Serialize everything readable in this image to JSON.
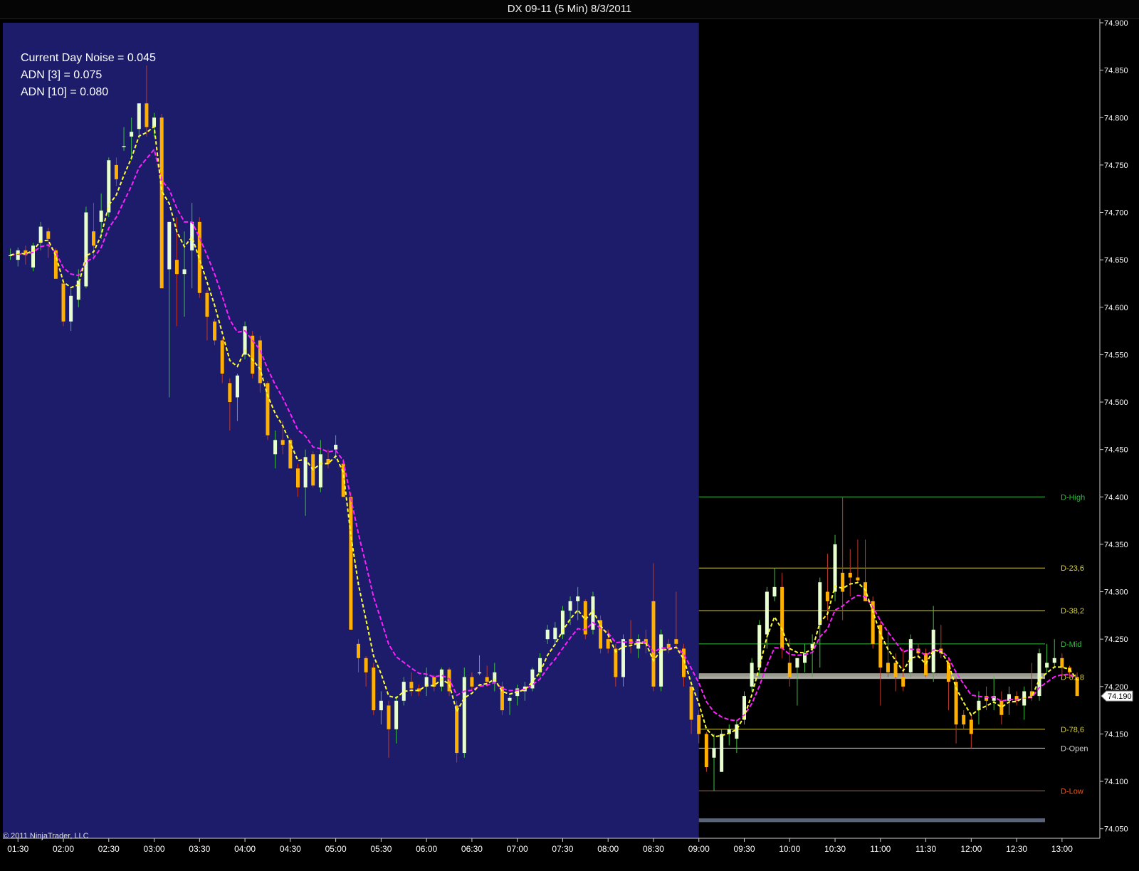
{
  "window": {
    "title": "DX 09-11 (5 Min)  8/3/2011"
  },
  "overlay": {
    "lines": [
      "Current Day Noise = 0.045",
      "ADN [3] = 0.075",
      "ADN [10] = 0.080"
    ],
    "copyright": "© 2011 NinjaTrader, LLC"
  },
  "chart_data": {
    "type": "candlestick",
    "instrument": "DX 09-11",
    "interval": "5 Min",
    "date": "8/3/2011",
    "ylim": [
      74.04,
      74.9
    ],
    "y_ticks": [
      "74.900",
      "74.850",
      "74.800",
      "74.750",
      "74.700",
      "74.650",
      "74.600",
      "74.550",
      "74.500",
      "74.450",
      "74.400",
      "74.350",
      "74.300",
      "74.250",
      "74.200",
      "74.150",
      "74.100",
      "74.050"
    ],
    "x_ticks": [
      "01:30",
      "02:00",
      "02:30",
      "03:00",
      "03:30",
      "04:00",
      "04:30",
      "05:00",
      "05:30",
      "06:00",
      "06:30",
      "07:00",
      "07:30",
      "08:00",
      "08:30",
      "09:00",
      "09:30",
      "10:00",
      "10:30",
      "11:00",
      "11:30",
      "12:00",
      "12:30",
      "13:00"
    ],
    "x_range": [
      "01:20",
      "13:25"
    ],
    "session_shading": {
      "from": "01:20",
      "to": "09:00",
      "color": "#1c1c6a"
    },
    "last_price": "74.190",
    "candles": [
      {
        "t": "01:25",
        "o": 74.655,
        "h": 74.662,
        "l": 74.65,
        "c": 74.655
      },
      {
        "t": "01:30",
        "o": 74.65,
        "h": 74.663,
        "l": 74.643,
        "c": 74.66
      },
      {
        "t": "01:35",
        "o": 74.66,
        "h": 74.665,
        "l": 74.645,
        "c": 74.655
      },
      {
        "t": "01:40",
        "o": 74.642,
        "h": 74.668,
        "l": 74.638,
        "c": 74.665
      },
      {
        "t": "01:45",
        "o": 74.668,
        "h": 74.69,
        "l": 74.66,
        "c": 74.685
      },
      {
        "t": "01:50",
        "o": 74.68,
        "h": 74.684,
        "l": 74.652,
        "c": 74.672
      },
      {
        "t": "01:55",
        "o": 74.66,
        "h": 74.662,
        "l": 74.63,
        "c": 74.63
      },
      {
        "t": "02:00",
        "o": 74.625,
        "h": 74.63,
        "l": 74.58,
        "c": 74.585
      },
      {
        "t": "02:05",
        "o": 74.585,
        "h": 74.62,
        "l": 74.575,
        "c": 74.612
      },
      {
        "t": "02:10",
        "o": 74.608,
        "h": 74.64,
        "l": 74.6,
        "c": 74.628
      },
      {
        "t": "02:15",
        "o": 74.622,
        "h": 74.706,
        "l": 74.62,
        "c": 74.7
      },
      {
        "t": "02:20",
        "o": 74.68,
        "h": 74.71,
        "l": 74.65,
        "c": 74.665
      },
      {
        "t": "02:25",
        "o": 74.69,
        "h": 74.72,
        "l": 74.672,
        "c": 74.702
      },
      {
        "t": "02:30",
        "o": 74.7,
        "h": 74.758,
        "l": 74.695,
        "c": 74.755
      },
      {
        "t": "02:35",
        "o": 74.75,
        "h": 74.758,
        "l": 74.728,
        "c": 74.735
      },
      {
        "t": "02:40",
        "o": 74.77,
        "h": 74.79,
        "l": 74.765,
        "c": 74.77
      },
      {
        "t": "02:45",
        "o": 74.78,
        "h": 74.8,
        "l": 74.755,
        "c": 74.785
      },
      {
        "t": "02:50",
        "o": 74.788,
        "h": 74.815,
        "l": 74.778,
        "c": 74.815
      },
      {
        "t": "02:55",
        "o": 74.815,
        "h": 74.855,
        "l": 74.78,
        "c": 74.79
      },
      {
        "t": "03:00",
        "o": 74.79,
        "h": 74.805,
        "l": 74.78,
        "c": 74.8
      },
      {
        "t": "03:05",
        "o": 74.8,
        "h": 74.804,
        "l": 74.62,
        "c": 74.62
      },
      {
        "t": "03:10",
        "o": 74.64,
        "h": 74.69,
        "l": 74.505,
        "c": 74.69
      },
      {
        "t": "03:15",
        "o": 74.65,
        "h": 74.695,
        "l": 74.58,
        "c": 74.635
      },
      {
        "t": "03:20",
        "o": 74.635,
        "h": 74.68,
        "l": 74.59,
        "c": 74.64
      },
      {
        "t": "03:25",
        "o": 74.66,
        "h": 74.71,
        "l": 74.62,
        "c": 74.69
      },
      {
        "t": "03:30",
        "o": 74.69,
        "h": 74.695,
        "l": 74.61,
        "c": 74.615
      },
      {
        "t": "03:35",
        "o": 74.615,
        "h": 74.618,
        "l": 74.565,
        "c": 74.59
      },
      {
        "t": "03:40",
        "o": 74.585,
        "h": 74.588,
        "l": 74.56,
        "c": 74.565
      },
      {
        "t": "03:45",
        "o": 74.565,
        "h": 74.568,
        "l": 74.52,
        "c": 74.53
      },
      {
        "t": "03:50",
        "o": 74.52,
        "h": 74.525,
        "l": 74.47,
        "c": 74.5
      },
      {
        "t": "03:55",
        "o": 74.505,
        "h": 74.53,
        "l": 74.48,
        "c": 74.528
      },
      {
        "t": "04:00",
        "o": 74.55,
        "h": 74.585,
        "l": 74.545,
        "c": 74.58
      },
      {
        "t": "04:05",
        "o": 74.57,
        "h": 74.575,
        "l": 74.525,
        "c": 74.53
      },
      {
        "t": "04:10",
        "o": 74.565,
        "h": 74.57,
        "l": 74.51,
        "c": 74.52
      },
      {
        "t": "04:15",
        "o": 74.52,
        "h": 74.522,
        "l": 74.46,
        "c": 74.465
      },
      {
        "t": "04:20",
        "o": 74.445,
        "h": 74.47,
        "l": 74.43,
        "c": 74.46
      },
      {
        "t": "04:25",
        "o": 74.46,
        "h": 74.48,
        "l": 74.445,
        "c": 74.455
      },
      {
        "t": "04:30",
        "o": 74.46,
        "h": 74.462,
        "l": 74.43,
        "c": 74.43
      },
      {
        "t": "04:35",
        "o": 74.43,
        "h": 74.435,
        "l": 74.4,
        "c": 74.41
      },
      {
        "t": "04:40",
        "o": 74.41,
        "h": 74.45,
        "l": 74.38,
        "c": 74.442
      },
      {
        "t": "04:45",
        "o": 74.445,
        "h": 74.448,
        "l": 74.41,
        "c": 74.412
      },
      {
        "t": "04:50",
        "o": 74.41,
        "h": 74.46,
        "l": 74.405,
        "c": 74.445
      },
      {
        "t": "04:55",
        "o": 74.44,
        "h": 74.45,
        "l": 74.43,
        "c": 74.435
      },
      {
        "t": "05:00",
        "o": 74.45,
        "h": 74.465,
        "l": 74.44,
        "c": 74.455
      },
      {
        "t": "05:05",
        "o": 74.435,
        "h": 74.44,
        "l": 74.4,
        "c": 74.4
      },
      {
        "t": "05:10",
        "o": 74.4,
        "h": 74.405,
        "l": 74.26,
        "c": 74.26
      },
      {
        "t": "05:15",
        "o": 74.245,
        "h": 74.25,
        "l": 74.215,
        "c": 74.23
      },
      {
        "t": "05:20",
        "o": 74.23,
        "h": 74.232,
        "l": 74.2,
        "c": 74.215
      },
      {
        "t": "05:25",
        "o": 74.22,
        "h": 74.225,
        "l": 74.17,
        "c": 74.175
      },
      {
        "t": "05:30",
        "o": 74.175,
        "h": 74.195,
        "l": 74.16,
        "c": 74.185
      },
      {
        "t": "05:35",
        "o": 74.18,
        "h": 74.185,
        "l": 74.125,
        "c": 74.155
      },
      {
        "t": "05:40",
        "o": 74.155,
        "h": 74.19,
        "l": 74.14,
        "c": 74.185
      },
      {
        "t": "05:45",
        "o": 74.185,
        "h": 74.21,
        "l": 74.18,
        "c": 74.205
      },
      {
        "t": "05:50",
        "o": 74.205,
        "h": 74.215,
        "l": 74.19,
        "c": 74.198
      },
      {
        "t": "05:55",
        "o": 74.198,
        "h": 74.202,
        "l": 74.19,
        "c": 74.195
      },
      {
        "t": "06:00",
        "o": 74.2,
        "h": 74.22,
        "l": 74.19,
        "c": 74.21
      },
      {
        "t": "06:05",
        "o": 74.21,
        "h": 74.212,
        "l": 74.195,
        "c": 74.2
      },
      {
        "t": "06:10",
        "o": 74.2,
        "h": 74.22,
        "l": 74.195,
        "c": 74.218
      },
      {
        "t": "06:15",
        "o": 74.218,
        "h": 74.22,
        "l": 74.19,
        "c": 74.195
      },
      {
        "t": "06:20",
        "o": 74.18,
        "h": 74.185,
        "l": 74.12,
        "c": 74.13
      },
      {
        "t": "06:25",
        "o": 74.13,
        "h": 74.22,
        "l": 74.125,
        "c": 74.21
      },
      {
        "t": "06:30",
        "o": 74.21,
        "h": 74.215,
        "l": 74.195,
        "c": 74.2
      },
      {
        "t": "06:35",
        "o": 74.215,
        "h": 74.233,
        "l": 74.212,
        "c": 74.215
      },
      {
        "t": "06:40",
        "o": 74.21,
        "h": 74.222,
        "l": 74.2,
        "c": 74.205
      },
      {
        "t": "06:45",
        "o": 74.205,
        "h": 74.225,
        "l": 74.195,
        "c": 74.215
      },
      {
        "t": "06:50",
        "o": 74.2,
        "h": 74.205,
        "l": 74.17,
        "c": 74.175
      },
      {
        "t": "06:55",
        "o": 74.185,
        "h": 74.19,
        "l": 74.17,
        "c": 74.188
      },
      {
        "t": "07:00",
        "o": 74.19,
        "h": 74.202,
        "l": 74.18,
        "c": 74.198
      },
      {
        "t": "07:05",
        "o": 74.195,
        "h": 74.205,
        "l": 74.185,
        "c": 74.2
      },
      {
        "t": "07:10",
        "o": 74.198,
        "h": 74.22,
        "l": 74.195,
        "c": 74.218
      },
      {
        "t": "07:15",
        "o": 74.215,
        "h": 74.235,
        "l": 74.21,
        "c": 74.23
      },
      {
        "t": "07:20",
        "o": 74.25,
        "h": 74.265,
        "l": 74.245,
        "c": 74.26
      },
      {
        "t": "07:25",
        "o": 74.25,
        "h": 74.268,
        "l": 74.245,
        "c": 74.262
      },
      {
        "t": "07:30",
        "o": 74.255,
        "h": 74.285,
        "l": 74.25,
        "c": 74.28
      },
      {
        "t": "07:35",
        "o": 74.28,
        "h": 74.295,
        "l": 74.265,
        "c": 74.29
      },
      {
        "t": "07:40",
        "o": 74.29,
        "h": 74.305,
        "l": 74.27,
        "c": 74.295
      },
      {
        "t": "07:45",
        "o": 74.29,
        "h": 74.292,
        "l": 74.25,
        "c": 74.255
      },
      {
        "t": "07:50",
        "o": 74.26,
        "h": 74.3,
        "l": 74.255,
        "c": 74.295
      },
      {
        "t": "07:55",
        "o": 74.27,
        "h": 74.275,
        "l": 74.235,
        "c": 74.24
      },
      {
        "t": "08:00",
        "o": 74.25,
        "h": 74.26,
        "l": 74.235,
        "c": 74.24
      },
      {
        "t": "08:05",
        "o": 74.24,
        "h": 74.245,
        "l": 74.2,
        "c": 74.21
      },
      {
        "t": "08:10",
        "o": 74.21,
        "h": 74.255,
        "l": 74.2,
        "c": 74.25
      },
      {
        "t": "08:15",
        "o": 74.25,
        "h": 74.27,
        "l": 74.235,
        "c": 74.245
      },
      {
        "t": "08:20",
        "o": 74.24,
        "h": 74.255,
        "l": 74.23,
        "c": 74.25
      },
      {
        "t": "08:25",
        "o": 74.25,
        "h": 74.26,
        "l": 74.235,
        "c": 74.245
      },
      {
        "t": "08:30",
        "o": 74.29,
        "h": 74.33,
        "l": 74.195,
        "c": 74.2
      },
      {
        "t": "08:35",
        "o": 74.2,
        "h": 74.26,
        "l": 74.195,
        "c": 74.255
      },
      {
        "t": "08:40",
        "o": 74.245,
        "h": 74.25,
        "l": 74.235,
        "c": 74.24
      },
      {
        "t": "08:45",
        "o": 74.25,
        "h": 74.3,
        "l": 74.24,
        "c": 74.245
      },
      {
        "t": "08:50",
        "o": 74.24,
        "h": 74.245,
        "l": 74.2,
        "c": 74.21
      },
      {
        "t": "08:55",
        "o": 74.2,
        "h": 74.205,
        "l": 74.15,
        "c": 74.165
      },
      {
        "t": "09:00",
        "o": 74.17,
        "h": 74.175,
        "l": 74.14,
        "c": 74.15
      },
      {
        "t": "09:05",
        "o": 74.15,
        "h": 74.152,
        "l": 74.11,
        "c": 74.115
      },
      {
        "t": "09:10",
        "o": 74.125,
        "h": 74.15,
        "l": 74.09,
        "c": 74.135
      },
      {
        "t": "09:15",
        "o": 74.11,
        "h": 74.155,
        "l": 74.11,
        "c": 74.15
      },
      {
        "t": "09:20",
        "o": 74.15,
        "h": 74.16,
        "l": 74.138,
        "c": 74.155
      },
      {
        "t": "09:25",
        "o": 74.145,
        "h": 74.165,
        "l": 74.13,
        "c": 74.16
      },
      {
        "t": "09:30",
        "o": 74.165,
        "h": 74.195,
        "l": 74.16,
        "c": 74.19
      },
      {
        "t": "09:35",
        "o": 74.2,
        "h": 74.23,
        "l": 74.195,
        "c": 74.225
      },
      {
        "t": "09:40",
        "o": 74.22,
        "h": 74.27,
        "l": 74.21,
        "c": 74.265
      },
      {
        "t": "09:45",
        "o": 74.255,
        "h": 74.305,
        "l": 74.24,
        "c": 74.3
      },
      {
        "t": "09:50",
        "o": 74.295,
        "h": 74.325,
        "l": 74.29,
        "c": 74.305
      },
      {
        "t": "09:55",
        "o": 74.305,
        "h": 74.32,
        "l": 74.23,
        "c": 74.24
      },
      {
        "t": "10:00",
        "o": 74.225,
        "h": 74.25,
        "l": 74.2,
        "c": 74.21
      },
      {
        "t": "10:05",
        "o": 74.22,
        "h": 74.23,
        "l": 74.18,
        "c": 74.23
      },
      {
        "t": "10:10",
        "o": 74.225,
        "h": 74.245,
        "l": 74.215,
        "c": 74.235
      },
      {
        "t": "10:15",
        "o": 74.24,
        "h": 74.255,
        "l": 74.21,
        "c": 74.245
      },
      {
        "t": "10:20",
        "o": 74.265,
        "h": 74.315,
        "l": 74.22,
        "c": 74.31
      },
      {
        "t": "10:25",
        "o": 74.3,
        "h": 74.34,
        "l": 74.27,
        "c": 74.29
      },
      {
        "t": "10:30",
        "o": 74.3,
        "h": 74.36,
        "l": 74.29,
        "c": 74.35
      },
      {
        "t": "10:35",
        "o": 74.32,
        "h": 74.4,
        "l": 74.27,
        "c": 74.3
      },
      {
        "t": "10:40",
        "o": 74.32,
        "h": 74.345,
        "l": 74.295,
        "c": 74.315
      },
      {
        "t": "10:45",
        "o": 74.315,
        "h": 74.355,
        "l": 74.31,
        "c": 74.312
      },
      {
        "t": "10:50",
        "o": 74.31,
        "h": 74.355,
        "l": 74.29,
        "c": 74.29
      },
      {
        "t": "10:55",
        "o": 74.29,
        "h": 74.295,
        "l": 74.24,
        "c": 74.245
      },
      {
        "t": "11:00",
        "o": 74.265,
        "h": 74.27,
        "l": 74.18,
        "c": 74.22
      },
      {
        "t": "11:05",
        "o": 74.225,
        "h": 74.26,
        "l": 74.21,
        "c": 74.215
      },
      {
        "t": "11:10",
        "o": 74.225,
        "h": 74.235,
        "l": 74.195,
        "c": 74.21
      },
      {
        "t": "11:15",
        "o": 74.21,
        "h": 74.24,
        "l": 74.195,
        "c": 74.2
      },
      {
        "t": "11:20",
        "o": 74.215,
        "h": 74.255,
        "l": 74.21,
        "c": 74.25
      },
      {
        "t": "11:25",
        "o": 74.24,
        "h": 74.245,
        "l": 74.23,
        "c": 74.235
      },
      {
        "t": "11:30",
        "o": 74.235,
        "h": 74.24,
        "l": 74.21,
        "c": 74.212
      },
      {
        "t": "11:35",
        "o": 74.215,
        "h": 74.285,
        "l": 74.205,
        "c": 74.26
      },
      {
        "t": "11:40",
        "o": 74.24,
        "h": 74.265,
        "l": 74.23,
        "c": 74.235
      },
      {
        "t": "11:45",
        "o": 74.225,
        "h": 74.23,
        "l": 74.175,
        "c": 74.205
      },
      {
        "t": "11:50",
        "o": 74.205,
        "h": 74.21,
        "l": 74.14,
        "c": 74.16
      },
      {
        "t": "11:55",
        "o": 74.17,
        "h": 74.175,
        "l": 74.155,
        "c": 74.16
      },
      {
        "t": "12:00",
        "o": 74.165,
        "h": 74.17,
        "l": 74.135,
        "c": 74.15
      },
      {
        "t": "12:05",
        "o": 74.175,
        "h": 74.195,
        "l": 74.16,
        "c": 74.185
      },
      {
        "t": "12:10",
        "o": 74.19,
        "h": 74.2,
        "l": 74.175,
        "c": 74.185
      },
      {
        "t": "12:15",
        "o": 74.185,
        "h": 74.21,
        "l": 74.175,
        "c": 74.19
      },
      {
        "t": "12:20",
        "o": 74.185,
        "h": 74.195,
        "l": 74.16,
        "c": 74.17
      },
      {
        "t": "12:25",
        "o": 74.185,
        "h": 74.2,
        "l": 74.17,
        "c": 74.192
      },
      {
        "t": "12:30",
        "o": 74.19,
        "h": 74.195,
        "l": 74.18,
        "c": 74.185
      },
      {
        "t": "12:35",
        "o": 74.18,
        "h": 74.2,
        "l": 74.165,
        "c": 74.195
      },
      {
        "t": "12:40",
        "o": 74.195,
        "h": 74.225,
        "l": 74.185,
        "c": 74.19
      },
      {
        "t": "12:45",
        "o": 74.19,
        "h": 74.24,
        "l": 74.185,
        "c": 74.235
      },
      {
        "t": "12:50",
        "o": 74.22,
        "h": 74.245,
        "l": 74.215,
        "c": 74.225
      },
      {
        "t": "12:55",
        "o": 74.225,
        "h": 74.25,
        "l": 74.22,
        "c": 74.23
      },
      {
        "t": "13:00",
        "o": 74.23,
        "h": 74.235,
        "l": 74.21,
        "c": 74.22
      },
      {
        "t": "13:05",
        "o": 74.22,
        "h": 74.222,
        "l": 74.21,
        "c": 74.215
      },
      {
        "t": "13:10",
        "o": 74.21,
        "h": 74.215,
        "l": 74.19,
        "c": 74.19
      }
    ],
    "levels": [
      {
        "label": "D-High",
        "value": 74.4,
        "color": "#2fbf3a"
      },
      {
        "label": "D-23,6",
        "value": 74.325,
        "color": "#d8d040"
      },
      {
        "label": "D-38,2",
        "value": 74.28,
        "color": "#d8d040"
      },
      {
        "label": "D-Mid",
        "value": 74.245,
        "color": "#2fbf3a"
      },
      {
        "label": "D-61,8",
        "value": 74.21,
        "color": "#d8d040"
      },
      {
        "label": "D-78,6",
        "value": 74.155,
        "color": "#d8d040"
      },
      {
        "label": "D-Open",
        "value": 74.135,
        "color": "#cfcfcf"
      },
      {
        "label": "D-Low",
        "value": 74.09,
        "color": "#e05a20"
      }
    ],
    "zones": [
      {
        "from": 74.208,
        "to": 74.214,
        "color": "#9a9a90"
      },
      {
        "from": 74.057,
        "to": 74.061,
        "color": "#5a6478"
      }
    ],
    "levels_start": "09:00",
    "colors": {
      "up_body": "#e8ffd0",
      "up_wick": "#3fbf3f",
      "down_body": "#ffb000",
      "down_wick": "#c03a2a",
      "ema_fast": "#ffff30",
      "ema_slow": "#ff20ff",
      "background": "#000000",
      "axis_text": "#ffffff"
    }
  }
}
